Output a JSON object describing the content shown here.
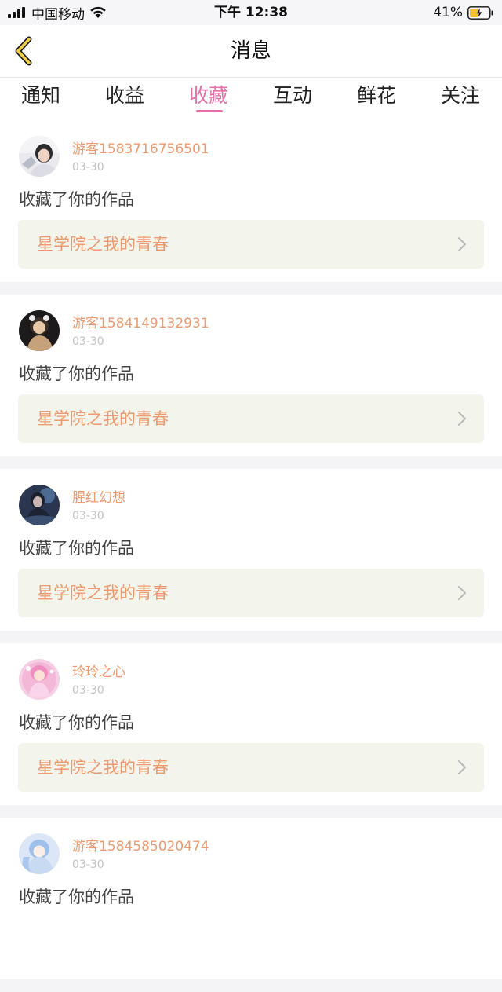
{
  "status_bar": {
    "carrier": "中国移动",
    "time": "下午 12:38",
    "battery": "41%"
  },
  "nav": {
    "title": "消息",
    "back_icon": "chevron-left-icon"
  },
  "tabs": [
    {
      "label": "通知",
      "active": false
    },
    {
      "label": "收益",
      "active": false
    },
    {
      "label": "收藏",
      "active": true
    },
    {
      "label": "互动",
      "active": false
    },
    {
      "label": "鲜花",
      "active": false
    },
    {
      "label": "关注",
      "active": false
    }
  ],
  "colors": {
    "accent_pink": "#e76fa8",
    "name_orange": "#ef9a6e",
    "link_bg": "#f3f4ec",
    "divider": "#f4f4f6"
  },
  "messages": [
    {
      "user": "游客1583716756501",
      "date": "03-30",
      "action": "收藏了你的作品",
      "work": "星学院之我的青春"
    },
    {
      "user": "游客1584149132931",
      "date": "03-30",
      "action": "收藏了你的作品",
      "work": "星学院之我的青春"
    },
    {
      "user": "腥红幻想",
      "date": "03-30",
      "action": "收藏了你的作品",
      "work": "星学院之我的青春"
    },
    {
      "user": "玲玲之心",
      "date": "03-30",
      "action": "收藏了你的作品",
      "work": "星学院之我的青春"
    },
    {
      "user": "游客1584585020474",
      "date": "03-30",
      "action": "收藏了你的作品",
      "work": ""
    }
  ]
}
